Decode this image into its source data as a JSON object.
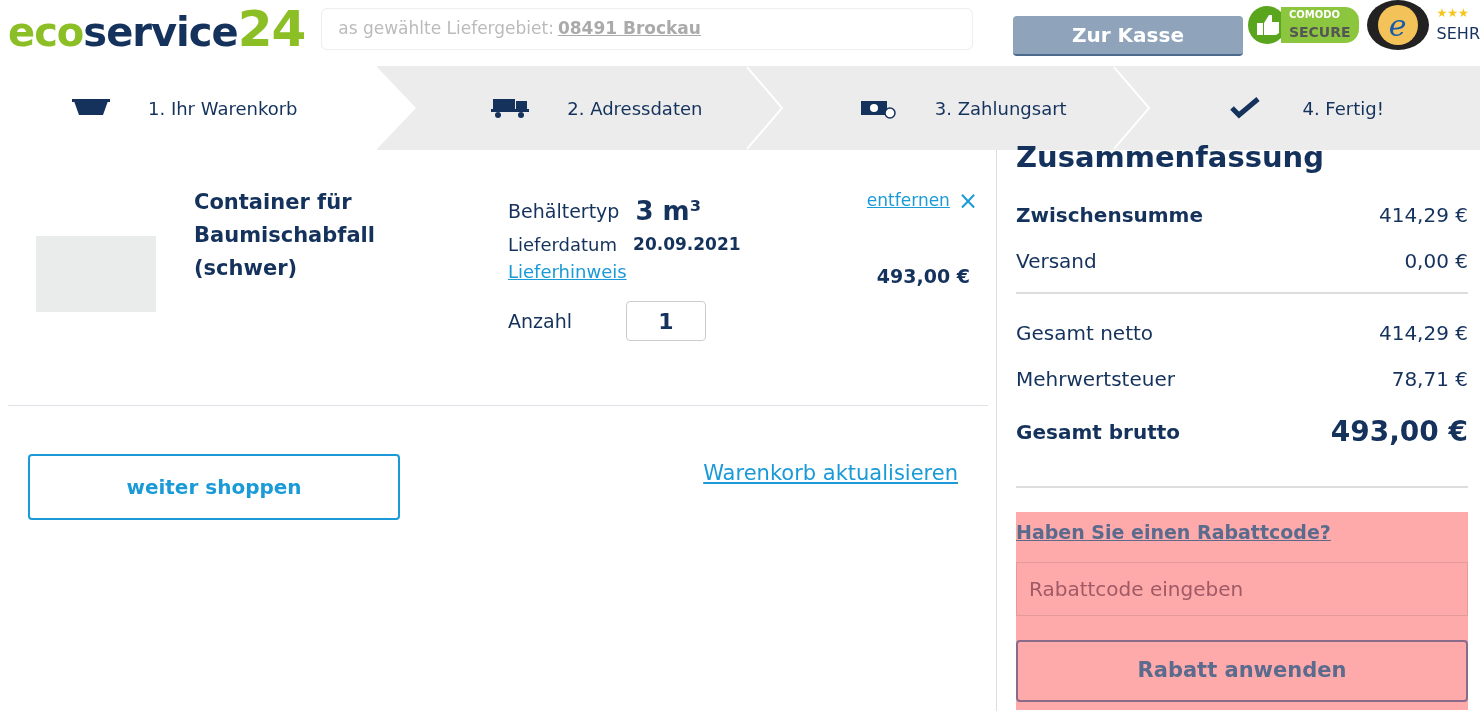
{
  "header": {
    "logo": [
      "eco",
      "service",
      "24"
    ],
    "notice": {
      "text": "as gewählte Liefergebiet:",
      "link": "08491 Brockau"
    },
    "checkout_button": "Zur Kasse",
    "seals": [
      {
        "kind": "comodo",
        "line1": "COMODO",
        "line2": "SECURE"
      },
      {
        "kind": "trusted",
        "letter": "e",
        "caption": "SEHR",
        "stars": 3
      }
    ]
  },
  "steps": [
    {
      "label": "1. Ihr Warenkorb",
      "kind": "skip",
      "selected": true
    },
    {
      "label": "2. Adressdaten",
      "kind": "truck",
      "selected": false
    },
    {
      "label": "3. Zahlungsart",
      "kind": "money",
      "selected": false
    },
    {
      "label": "4. Fertig!",
      "kind": "check",
      "selected": false
    }
  ],
  "cart_item": {
    "name": "Container für Baumischabfall (schwer)",
    "properties": [
      {
        "label": "Behältertyp",
        "value": "3 m³",
        "kind": "large"
      },
      {
        "label": "Lieferdatum",
        "value": "20.09.2021",
        "kind": "small"
      }
    ],
    "note_link": "Lieferhinweis",
    "quantity_label": "Anzahl",
    "quantity": "1",
    "remove_link": "entfernen",
    "remove_symbol": "×",
    "price": "493,00 €"
  },
  "actions": {
    "continue_button": "weiter shoppen",
    "update_link": "Warenkorb aktualisieren"
  },
  "summary": {
    "title": "Zusammenfassung",
    "groups": [
      [
        {
          "label": "Zwischensumme",
          "value": "414,29 €",
          "kind": "bold"
        },
        {
          "label": "Versand",
          "value": "0,00 €",
          "kind": "plain"
        }
      ],
      [
        {
          "label": "Gesamt netto",
          "value": "414,29 €",
          "kind": "plain"
        },
        {
          "label": "Mehrwertsteuer",
          "value": "78,71 €",
          "kind": "plain"
        },
        {
          "label": "Gesamt brutto",
          "value": "493,00 €",
          "kind": "total"
        }
      ]
    ],
    "discount": {
      "link": "Haben Sie einen Rabattcode?",
      "placeholder": "Rabattcode eingeben",
      "button": "Rabatt anwenden"
    }
  }
}
